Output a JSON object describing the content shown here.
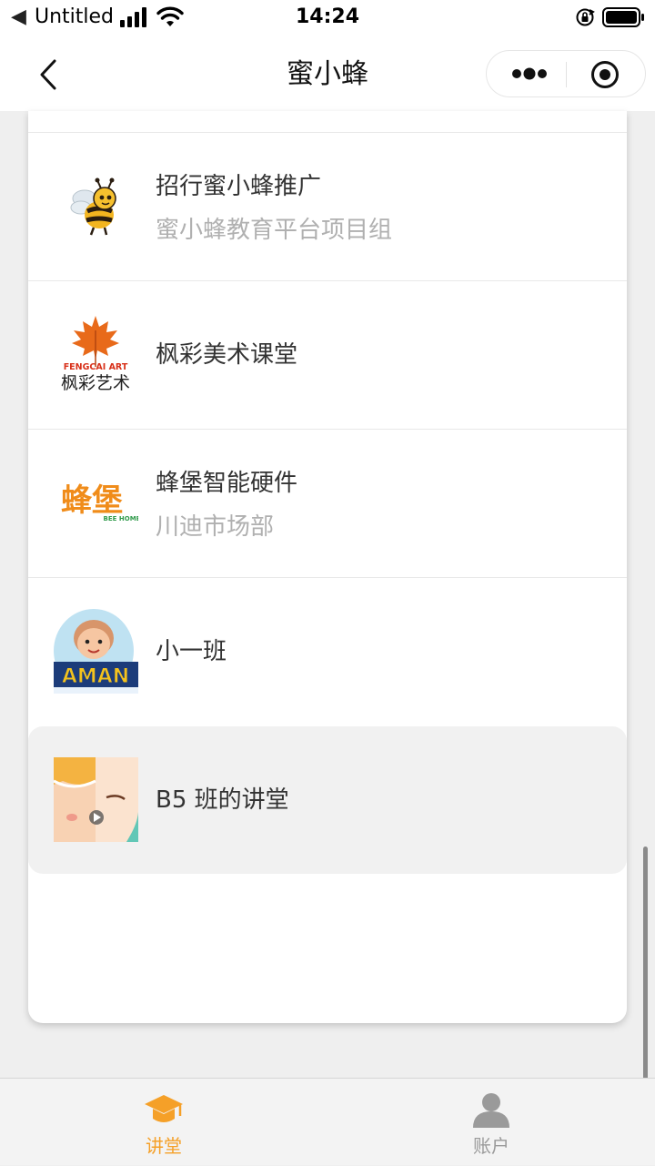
{
  "status_bar": {
    "back_glyph": "◀",
    "app_name": "Untitled",
    "time": "14:24"
  },
  "nav": {
    "title": "蜜小蜂"
  },
  "list": [
    {
      "title": "招行蜜小蜂推广",
      "subtitle": "蜜小蜂教育平台项目组",
      "icon": "bee-logo-icon"
    },
    {
      "title": "枫彩美术课堂",
      "subtitle": "",
      "icon": "fengcai-art-logo-icon",
      "logo_text": "FENGCAI ART",
      "logo_cn": "枫彩艺术"
    },
    {
      "title": "蜂堡智能硬件",
      "subtitle": "川迪市场部",
      "icon": "beehome-logo-icon",
      "logo_text": "BEE HOME",
      "logo_cn": "蜂堡"
    },
    {
      "title": "小一班",
      "subtitle": "",
      "icon": "cartoon-kid-logo-icon",
      "logo_text": "AMAN"
    },
    {
      "title": "B5 班的讲堂",
      "subtitle": "",
      "icon": "baby-video-thumbnail-icon",
      "selected": true
    }
  ],
  "tabbar": {
    "tabs": [
      {
        "label": "讲堂",
        "icon": "graduation-cap-icon",
        "active": true
      },
      {
        "label": "账户",
        "icon": "user-icon",
        "active": false
      }
    ]
  },
  "colors": {
    "accent": "#f5a028",
    "inactive": "#9a9a9a",
    "subtitle": "#b0b0b0"
  }
}
